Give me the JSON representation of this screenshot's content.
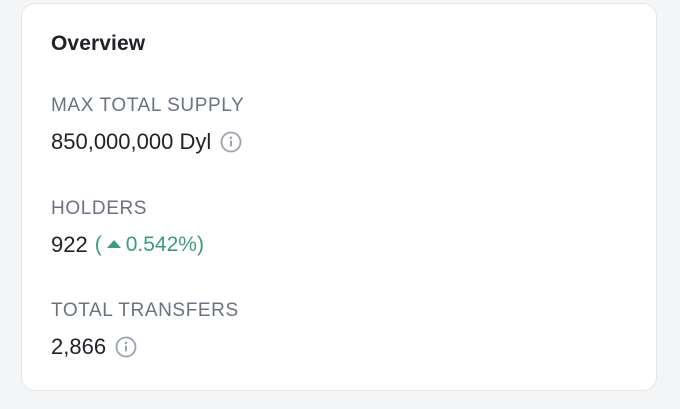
{
  "overview": {
    "title": "Overview",
    "max_total_supply": {
      "label": "MAX TOTAL SUPPLY",
      "value": "850,000,000 Dyl"
    },
    "holders": {
      "label": "HOLDERS",
      "value": "922",
      "change_open": "(",
      "change_value": "0.542%)",
      "change_direction_icon": "triangle-up-icon"
    },
    "total_transfers": {
      "label": "TOTAL TRANSFERS",
      "value": "2,866"
    }
  },
  "colors": {
    "positive": "#3d9a7c",
    "label": "#6b7280",
    "text": "#1f2328",
    "icon": "#9ca3af"
  }
}
